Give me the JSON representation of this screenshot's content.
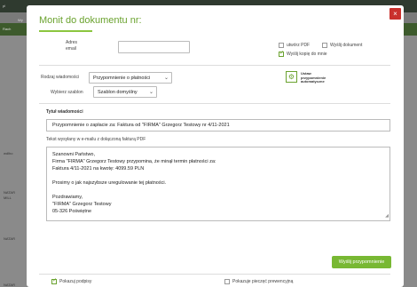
{
  "modal": {
    "title": "Monit do dokumentu nr:",
    "close": "×"
  },
  "form": {
    "email_label_1": "Adres",
    "email_label_2": "email",
    "email_value": "",
    "create_pdf": "utwórz PDF",
    "send_document": "Wyślij dokument",
    "send_copy": "Wyślij kopię do mnie",
    "message_type_label": "Rodzaj wiadomości",
    "message_type_value": "Przypomnienie o płatności",
    "template_label": "Wybierz szablon",
    "template_value": "Szablon domyślny",
    "auto_reminder_1": "Ustaw",
    "auto_reminder_2": "przypomnienie",
    "auto_reminder_3": "automatyczne",
    "subject_label": "Tytuł wiadomości",
    "subject_value": "Przypomnienie o zapłacie za: Faktura od \"FIRMA\" Grzegorz Testowy nr 4/11-2021",
    "body_label": "Tekst wysyłany w e-mailu z dołączoną fakturą PDF",
    "body_lines": [
      "Szanowni Państwo,",
      "Firma \"FIRMA\" Grzegorz Testowy przypomina, że minął termin płatności za:",
      "Faktura 4/11-2021 na kwotę: 4099.59 PLN",
      "",
      "Prosimy o jak najszybsze uregulowanie tej płatności.",
      "",
      "Pozdrawiamy,",
      "\"FIRMA\" Grzegorz Testowy",
      "05-326 Poświętne"
    ],
    "send_button": "Wyślij przypomnienie",
    "show_signatures": "Pokazuj podpisy",
    "show_stamp": "Pokazuje pieczęć prewencyjną"
  },
  "background": {
    "top_left": "pl",
    "row1": "Wy",
    "row2": "Rach",
    "item1": "wdlho",
    "item2": "NATAR",
    "item3": "MILL",
    "item4": "NATAR",
    "item5": "NATAR"
  },
  "colors": {
    "accent": "#6aa22e",
    "button": "#78b833",
    "close": "#c9302c"
  }
}
